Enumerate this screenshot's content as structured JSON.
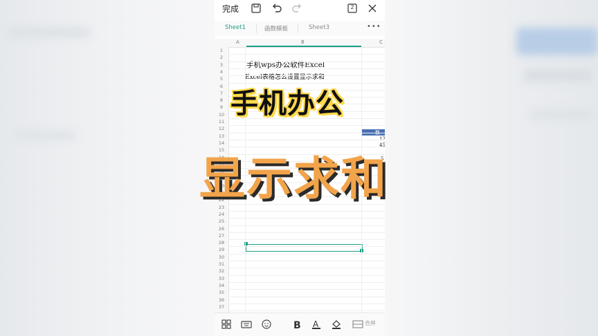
{
  "toolbar": {
    "done_label": "完成",
    "save_icon": "save-icon",
    "undo_icon": "undo-icon",
    "redo_icon": "redo-icon",
    "window_count": "2",
    "close_icon": "close-icon"
  },
  "tabs": [
    {
      "label": "Sheet1",
      "active": true
    },
    {
      "label": "函数模板",
      "active": false
    },
    {
      "label": "Sheet3",
      "active": false
    }
  ],
  "more_label": "•••",
  "columns": [
    "A",
    "B",
    "C"
  ],
  "rows": [
    "1",
    "2",
    "3",
    "4",
    "5",
    "6",
    "7",
    "8",
    "9",
    "10",
    "11",
    "12",
    "13",
    "14",
    "15",
    "16",
    "17",
    "18",
    "19",
    "20",
    "21",
    "22",
    "23",
    "24",
    "25",
    "26",
    "27",
    "28",
    "29",
    "30",
    "31",
    "32",
    "33",
    "34",
    "35",
    "36",
    "37"
  ],
  "cells": {
    "b4": "手机wps办公软件Excel",
    "b5": "Excel表格怎么设置显示求和",
    "c11": "数",
    "c12": "12",
    "c13": "45",
    "c15": "5",
    "c16": "8"
  },
  "overlay": {
    "line1": "手机办公",
    "line2": "显示求和"
  },
  "bottom": {
    "merge_label": "合并"
  },
  "colors": {
    "accent": "#1f9e86",
    "overlay1_bg": "#ffd84a",
    "overlay2_fill": "#f2a44b",
    "header_blue": "#4a6fb3"
  }
}
